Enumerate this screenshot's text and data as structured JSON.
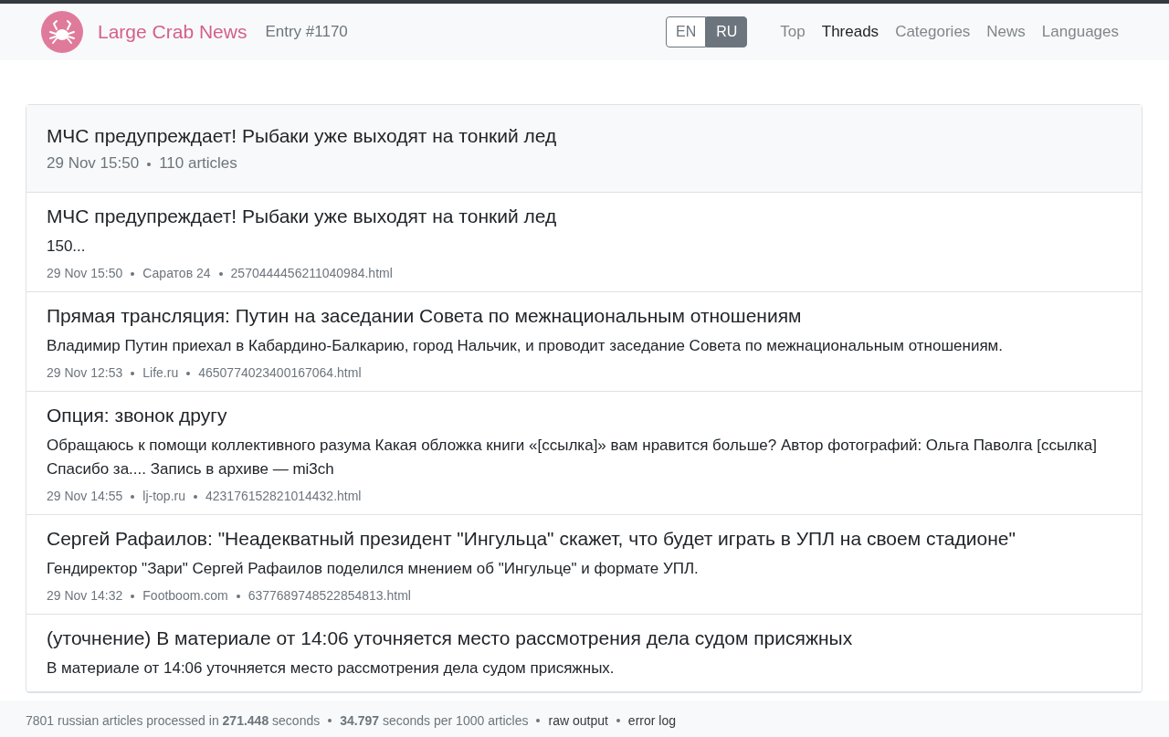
{
  "navbar": {
    "brand": "Large Crab News",
    "entry": "Entry #1170",
    "languages": [
      {
        "label": "EN",
        "selected": false
      },
      {
        "label": "RU",
        "selected": true
      }
    ],
    "links": [
      {
        "label": "Top",
        "selected": false
      },
      {
        "label": "Threads",
        "selected": true
      },
      {
        "label": "Categories",
        "selected": false
      },
      {
        "label": "News",
        "selected": false
      },
      {
        "label": "Languages",
        "selected": false
      }
    ]
  },
  "thread": {
    "title": "МЧС предупреждает! Рыбаки уже выходят на тонкий лед",
    "time": "29 Nov 15:50",
    "count": "110 articles"
  },
  "articles": [
    {
      "title": "МЧС предупреждает! Рыбаки уже выходят на тонкий лед",
      "snippet": "150...",
      "time": "29 Nov 15:50",
      "source": "Саратов 24",
      "file": "2570444456211040984.html"
    },
    {
      "title": "Прямая трансляция: Путин на заседании Совета по межнациональным отношениям",
      "snippet": "Владимир Путин приехал в Кабардино-Балкарию, город Нальчик, и проводит заседание Совета по межнациональным отношениям.",
      "time": "29 Nov 12:53",
      "source": "Life.ru",
      "file": "4650774023400167064.html"
    },
    {
      "title": "Опция: звонок другу",
      "snippet": "Обращаюсь к помощи коллективного разума Какая обложка книги «[ссылка]» вам нравится больше? Автор фотографий: Ольга Паволга [ссылка] Спасибо за.... Запись в архиве — mi3ch",
      "time": "29 Nov 14:55",
      "source": "lj-top.ru",
      "file": "423176152821014432.html"
    },
    {
      "title": "Сергей Рафаилов: \"Неадекватный президент \"Ингульца\" скажет, что будет играть в УПЛ на своем стадионе\"",
      "snippet": "Гендиректор \"Зари\" Сергей Рафаилов поделился мнением об \"Ингульце\" и формате УПЛ.",
      "time": "29 Nov 14:32",
      "source": "Footboom.com",
      "file": "6377689748522854813.html"
    },
    {
      "title": "(уточнение) В материале от 14:06 уточняется место рассмотрения дела судом присяжных",
      "snippet": "В материале от 14:06 уточняется место рассмотрения дела судом присяжных."
    }
  ],
  "footer": {
    "stats": [
      "7801 russian articles processed in **271.448** seconds",
      "**34.797** seconds per 1000 articles"
    ],
    "links": [
      "raw output",
      "error log"
    ]
  }
}
